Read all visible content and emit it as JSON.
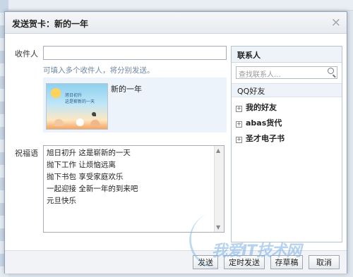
{
  "dialog": {
    "title": "发送贺卡：新的一年",
    "close_glyph": "×"
  },
  "form": {
    "recipient_label": "收件人",
    "recipient_value": "",
    "hint": "可填入多个收件人，将分别发送。",
    "card": {
      "name": "新的一年",
      "thumb_text_line1": "旭日初升",
      "thumb_text_line2": "这是崭新的一天"
    },
    "message_label": "祝福语",
    "message_lines": [
      "旭日初升 这是崭新的一天",
      "抛下工作 让烦恼远离",
      "抛下书包 享受家庭欢乐",
      "一起迎接 全新一年的到来吧",
      "元旦快乐"
    ]
  },
  "contacts": {
    "header": "联系人",
    "search_placeholder": "查找联系人...",
    "tab": "QQ好友",
    "groups": [
      "我的好友",
      "abas货代",
      "圣才电子书"
    ]
  },
  "footer": {
    "send": "发送",
    "schedule": "定时发送",
    "save_draft": "存草稿",
    "cancel": "取消"
  },
  "watermark": "我爱IT技术网"
}
